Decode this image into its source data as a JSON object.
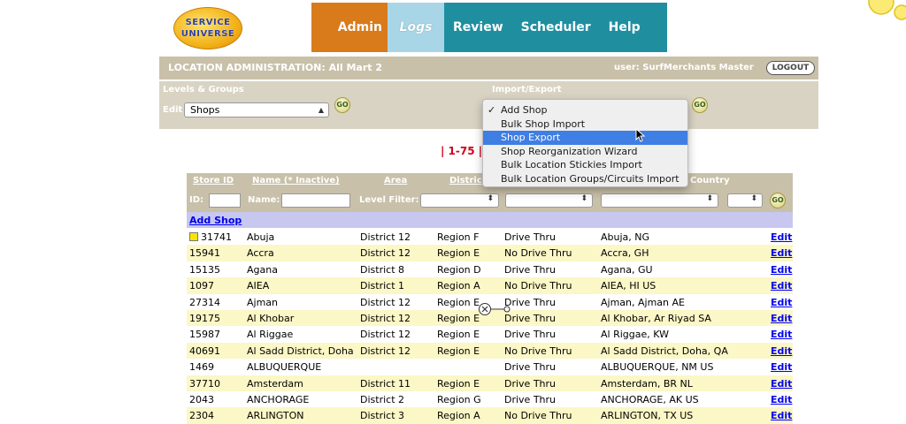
{
  "logo": {
    "line1": "SERVICE",
    "line2": "UNIVERSE"
  },
  "nav": {
    "items": [
      "Admin",
      "Logs",
      "Review",
      "Scheduler",
      "Help"
    ]
  },
  "header": {
    "title": "LOCATION ADMINISTRATION: All Mart 2",
    "user": "user: SurfMerchants Master",
    "logout": "LOGOUT"
  },
  "levels": {
    "label": "Levels & Groups",
    "edit_label": "Edit",
    "select_value": "Shops",
    "go": "GO"
  },
  "import_export": {
    "label": "Import/Export",
    "go": "GO",
    "options": [
      "Add Shop",
      "Bulk Shop Import",
      "Shop Export",
      "Shop Reorganization Wizard",
      "Bulk Location Stickies Import",
      "Bulk Location Groups/Circuits Import"
    ],
    "checked": "Add Shop",
    "highlighted": "Shop Export"
  },
  "pager": {
    "text": "| 1-75 |"
  },
  "table": {
    "headers": {
      "store_id": "Store ID",
      "name": "Name (* Inactive)",
      "area": "Area",
      "district": "Distric",
      "country": "Country"
    },
    "filters": {
      "id_label": "ID:",
      "name_label": "Name:",
      "level_label": "Level Filter:",
      "go": "GO"
    },
    "add_label": "Add Shop",
    "edit_label": "Edit",
    "rows": [
      {
        "id": "31741",
        "name": "Abuja",
        "area": "District 12",
        "region": "Region F",
        "drive": "Drive Thru",
        "location": "Abuja, NG"
      },
      {
        "id": "15941",
        "name": "Accra",
        "area": "District 12",
        "region": "Region E",
        "drive": "No Drive Thru",
        "location": "Accra, GH"
      },
      {
        "id": "15135",
        "name": "Agana",
        "area": "District 8",
        "region": "Region D",
        "drive": "Drive Thru",
        "location": "Agana, GU"
      },
      {
        "id": "1097",
        "name": "AIEA",
        "area": "District 1",
        "region": "Region A",
        "drive": "No Drive Thru",
        "location": "AIEA, HI US"
      },
      {
        "id": "27314",
        "name": "Ajman",
        "area": "District 12",
        "region": "Region E",
        "drive": "Drive Thru",
        "location": "Ajman, Ajman AE"
      },
      {
        "id": "19175",
        "name": "Al Khobar",
        "area": "District 12",
        "region": "Region E",
        "drive": "Drive Thru",
        "location": "Al Khobar, Ar Riyad SA"
      },
      {
        "id": "15987",
        "name": "Al Riggae",
        "area": "District 12",
        "region": "Region E",
        "drive": "Drive Thru",
        "location": "Al Riggae, KW"
      },
      {
        "id": "40691",
        "name": "Al Sadd District, Doha",
        "area": "District 12",
        "region": "Region E",
        "drive": "No Drive Thru",
        "location": "Al Sadd District, Doha, QA"
      },
      {
        "id": "1469",
        "name": "ALBUQUERQUE",
        "area": "",
        "region": "",
        "drive": "Drive Thru",
        "location": "ALBUQUERQUE, NM US"
      },
      {
        "id": "37710",
        "name": "Amsterdam",
        "area": "District 11",
        "region": "Region E",
        "drive": "Drive Thru",
        "location": "Amsterdam, BR NL"
      },
      {
        "id": "2043",
        "name": "ANCHORAGE",
        "area": "District 2",
        "region": "Region G",
        "drive": "Drive Thru",
        "location": "ANCHORAGE, AK US"
      },
      {
        "id": "2304",
        "name": "ARLINGTON",
        "area": "District 3",
        "region": "Region A",
        "drive": "No Drive Thru",
        "location": "ARLINGTON, TX US"
      }
    ]
  },
  "colors": {
    "nav_admin": "#d97a1b",
    "nav_logs": "#a9d6e7",
    "nav_bar": "#1f8fa0",
    "header_bg": "#c9c0a9",
    "row_alt": "#fbf7c6",
    "add_row": "#c7c7ef",
    "link": "#0000ee",
    "pager": "#d0021b",
    "highlight": "#3f7ee3"
  }
}
